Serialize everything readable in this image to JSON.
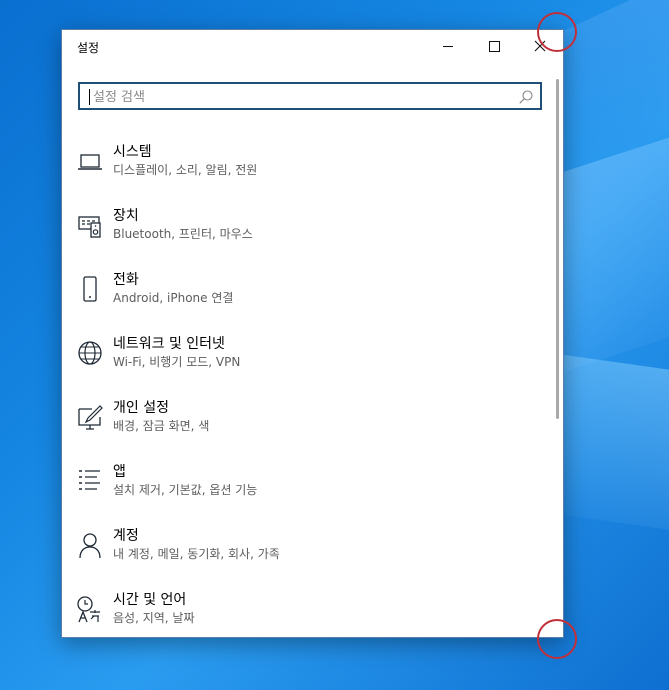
{
  "window": {
    "title": "설정",
    "minimize_icon": "minimize-icon",
    "maximize_icon": "maximize-icon",
    "close_icon": "close-icon"
  },
  "search": {
    "placeholder": "설정 검색",
    "value": "",
    "icon": "search-icon"
  },
  "categories": [
    {
      "title": "시스템",
      "subtitle": "디스플레이, 소리, 알림, 전원",
      "icon": "laptop-icon"
    },
    {
      "title": "장치",
      "subtitle": "Bluetooth, 프린터, 마우스",
      "icon": "devices-icon"
    },
    {
      "title": "전화",
      "subtitle": "Android, iPhone 연결",
      "icon": "phone-icon"
    },
    {
      "title": "네트워크 및 인터넷",
      "subtitle": "Wi-Fi, 비행기 모드, VPN",
      "icon": "globe-icon"
    },
    {
      "title": "개인 설정",
      "subtitle": "배경, 잠금 화면, 색",
      "icon": "paint-brush-icon"
    },
    {
      "title": "앱",
      "subtitle": "설치 제거, 기본값, 옵션 기능",
      "icon": "apps-list-icon"
    },
    {
      "title": "계정",
      "subtitle": "내 계정, 메일, 동기화, 회사, 가족",
      "icon": "person-icon"
    },
    {
      "title": "시간 및 언어",
      "subtitle": "음성, 지역, 날짜",
      "icon": "time-language-icon"
    }
  ],
  "colors": {
    "accent_border": "#1f4e79",
    "annotation_circle": "#c0303a",
    "desktop_blue": "#1586e2"
  }
}
